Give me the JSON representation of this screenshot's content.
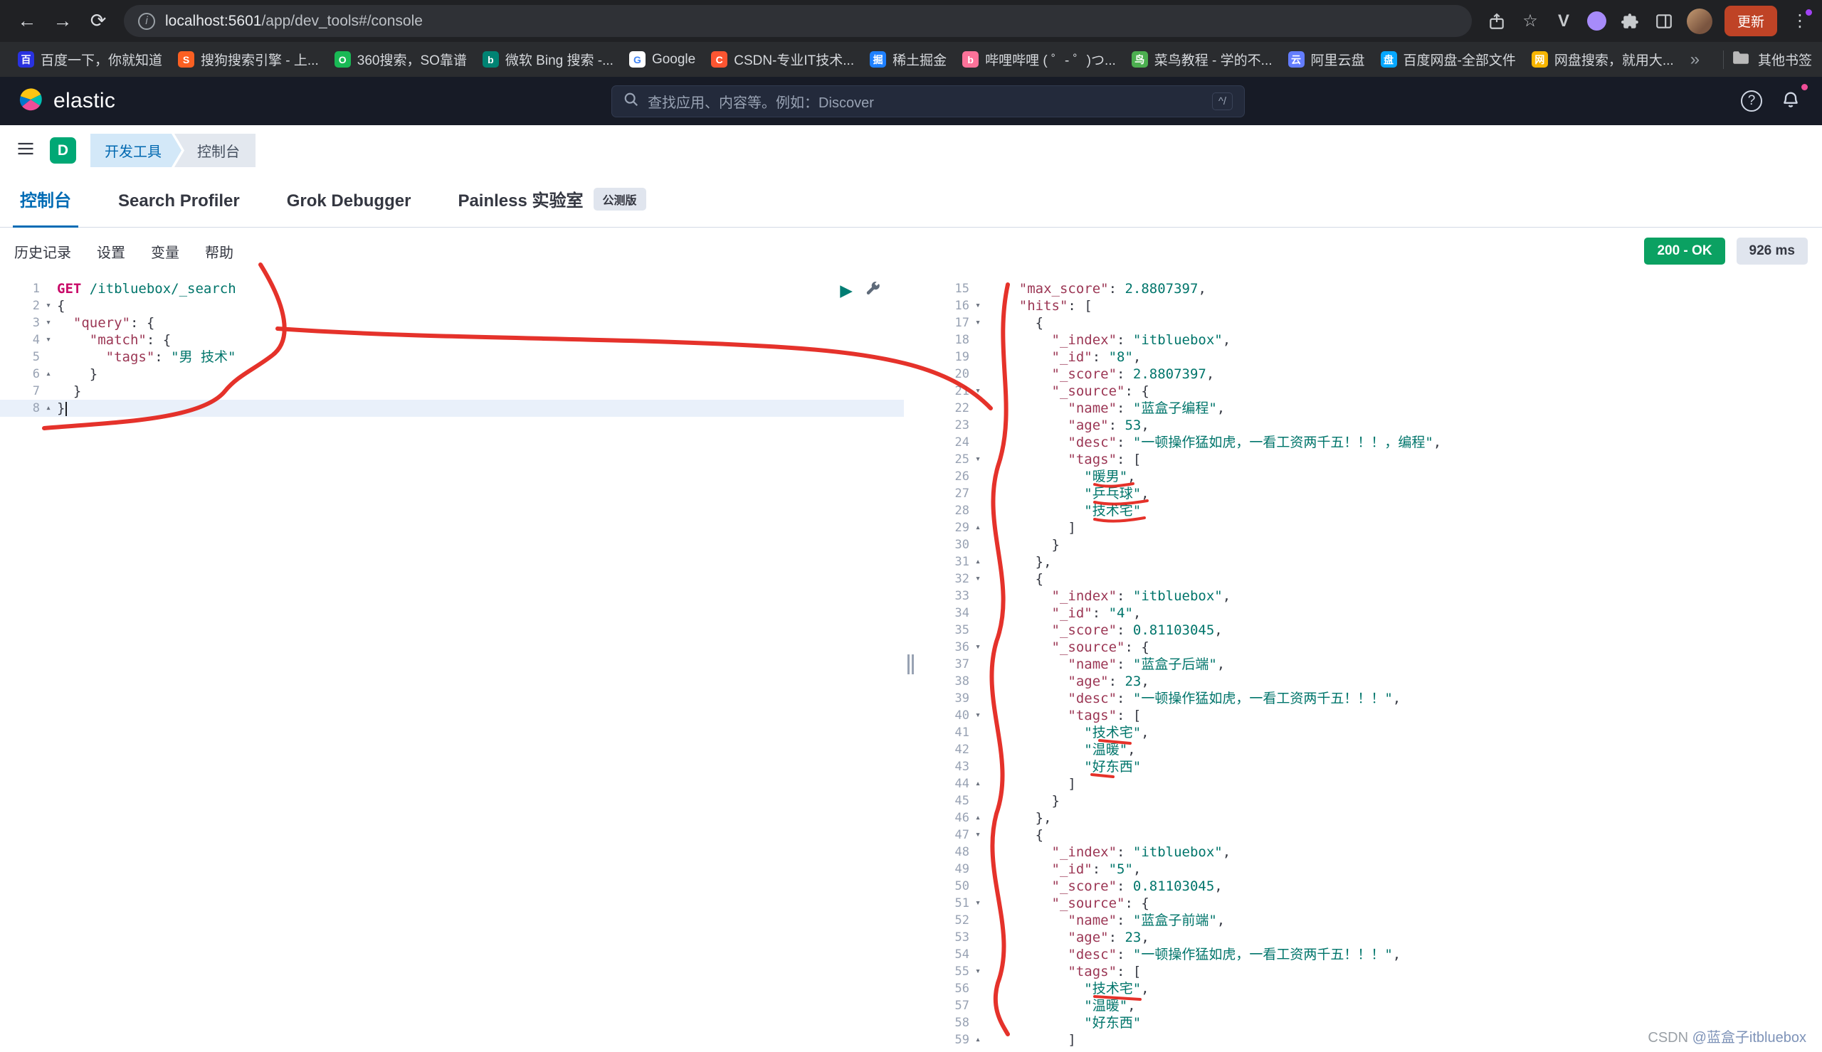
{
  "browser": {
    "url_host": "localhost:5601",
    "url_path": "/app/dev_tools#/console",
    "update_button": "更新",
    "overflow_chevron": "»",
    "other_bookmarks": "其他书签",
    "bookmarks": [
      {
        "label": "百度一下，你就知道",
        "glyph": "百",
        "color": "#2932e1"
      },
      {
        "label": "搜狗搜索引擎 - 上...",
        "glyph": "S",
        "color": "#fb6022"
      },
      {
        "label": "360搜索，SO靠谱",
        "glyph": "O",
        "color": "#19b955"
      },
      {
        "label": "微软 Bing 搜索 -...",
        "glyph": "b",
        "color": "#008373"
      },
      {
        "label": "Google",
        "glyph": "G",
        "color": "#ffffff",
        "fg": "#4285F4"
      },
      {
        "label": "CSDN-专业IT技术...",
        "glyph": "C",
        "color": "#fc5531"
      },
      {
        "label": "稀土掘金",
        "glyph": "掘",
        "color": "#1e80ff"
      },
      {
        "label": "哔哩哔哩 ( ゜- ゜)つ...",
        "glyph": "b",
        "color": "#fb7299"
      },
      {
        "label": "菜鸟教程 - 学的不...",
        "glyph": "鸟",
        "color": "#4caf50"
      },
      {
        "label": "阿里云盘",
        "glyph": "云",
        "color": "#637dff"
      },
      {
        "label": "百度网盘-全部文件",
        "glyph": "盘",
        "color": "#06a7ff"
      },
      {
        "label": "网盘搜索，就用大...",
        "glyph": "网",
        "color": "#f7b500"
      }
    ]
  },
  "header": {
    "brand": "elastic",
    "search_placeholder": "查找应用、内容等。例如：Discover",
    "search_shortcut": "^/"
  },
  "breadcrumbs": {
    "menu_badge": "D",
    "items": [
      {
        "label": "开发工具"
      },
      {
        "label": "控制台"
      }
    ]
  },
  "tabs": [
    {
      "label": "控制台",
      "active": true
    },
    {
      "label": "Search Profiler"
    },
    {
      "label": "Grok Debugger"
    },
    {
      "label": "Painless 实验室",
      "badge": "公测版"
    }
  ],
  "toolbar": {
    "links": [
      "历史记录",
      "设置",
      "变量",
      "帮助"
    ],
    "status_badge": "200 - OK",
    "time_badge": "926 ms"
  },
  "colors": {
    "accent_blue": "#006bb4",
    "success_green": "#0ba162",
    "annotation_red": "#e32119"
  },
  "editor": {
    "lines": [
      {
        "n": 1,
        "i": 0,
        "t": [
          [
            "m",
            "GET"
          ],
          [
            "p",
            " "
          ],
          [
            "u",
            "/itbluebox/_search"
          ]
        ]
      },
      {
        "n": 2,
        "i": 0,
        "f": "d",
        "t": [
          [
            "p",
            "{"
          ]
        ]
      },
      {
        "n": 3,
        "i": 2,
        "f": "d",
        "t": [
          [
            "k",
            "\"query\""
          ],
          [
            "p",
            ": {"
          ]
        ]
      },
      {
        "n": 4,
        "i": 4,
        "f": "d",
        "t": [
          [
            "k",
            "\"match\""
          ],
          [
            "p",
            ": {"
          ]
        ]
      },
      {
        "n": 5,
        "i": 6,
        "t": [
          [
            "k",
            "\"tags\""
          ],
          [
            "p",
            ": "
          ],
          [
            "s",
            "\"男 技术\""
          ]
        ]
      },
      {
        "n": 6,
        "i": 4,
        "f": "u",
        "t": [
          [
            "p",
            "}"
          ]
        ]
      },
      {
        "n": 7,
        "i": 2,
        "t": [
          [
            "p",
            "}"
          ]
        ]
      },
      {
        "n": 8,
        "i": 0,
        "f": "u",
        "active": true,
        "cursor": true,
        "t": [
          [
            "p",
            "}"
          ]
        ]
      }
    ]
  },
  "response": {
    "lines": [
      {
        "n": 15,
        "i": 4,
        "t": [
          [
            "k",
            "\"max_score\""
          ],
          [
            "p",
            ": "
          ],
          [
            "n",
            "2.8807397"
          ],
          [
            "p",
            ","
          ]
        ]
      },
      {
        "n": 16,
        "i": 4,
        "f": "d",
        "t": [
          [
            "k",
            "\"hits\""
          ],
          [
            "p",
            ": ["
          ]
        ]
      },
      {
        "n": 17,
        "i": 6,
        "f": "d",
        "t": [
          [
            "p",
            "{"
          ]
        ]
      },
      {
        "n": 18,
        "i": 8,
        "t": [
          [
            "k",
            "\"_index\""
          ],
          [
            "p",
            ": "
          ],
          [
            "s",
            "\"itbluebox\""
          ],
          [
            "p",
            ","
          ]
        ]
      },
      {
        "n": 19,
        "i": 8,
        "t": [
          [
            "k",
            "\"_id\""
          ],
          [
            "p",
            ": "
          ],
          [
            "s",
            "\"8\""
          ],
          [
            "p",
            ","
          ]
        ]
      },
      {
        "n": 20,
        "i": 8,
        "t": [
          [
            "k",
            "\"_score\""
          ],
          [
            "p",
            ": "
          ],
          [
            "n",
            "2.8807397"
          ],
          [
            "p",
            ","
          ]
        ]
      },
      {
        "n": 21,
        "i": 8,
        "f": "d",
        "t": [
          [
            "k",
            "\"_source\""
          ],
          [
            "p",
            ": {"
          ]
        ]
      },
      {
        "n": 22,
        "i": 10,
        "t": [
          [
            "k",
            "\"name\""
          ],
          [
            "p",
            ": "
          ],
          [
            "s",
            "\"蓝盒子编程\""
          ],
          [
            "p",
            ","
          ]
        ]
      },
      {
        "n": 23,
        "i": 10,
        "t": [
          [
            "k",
            "\"age\""
          ],
          [
            "p",
            ": "
          ],
          [
            "n",
            "53"
          ],
          [
            "p",
            ","
          ]
        ]
      },
      {
        "n": 24,
        "i": 10,
        "t": [
          [
            "k",
            "\"desc\""
          ],
          [
            "p",
            ": "
          ],
          [
            "s",
            "\"一顿操作猛如虎，一看工资两千五！！！，编程\""
          ],
          [
            "p",
            ","
          ]
        ]
      },
      {
        "n": 25,
        "i": 10,
        "f": "d",
        "t": [
          [
            "k",
            "\"tags\""
          ],
          [
            "p",
            ": ["
          ]
        ]
      },
      {
        "n": 26,
        "i": 12,
        "t": [
          [
            "s",
            "\"暖男\""
          ],
          [
            "p",
            ","
          ]
        ]
      },
      {
        "n": 27,
        "i": 12,
        "t": [
          [
            "s",
            "\"乒乓球\""
          ],
          [
            "p",
            ","
          ]
        ]
      },
      {
        "n": 28,
        "i": 12,
        "t": [
          [
            "s",
            "\"技术宅\""
          ]
        ]
      },
      {
        "n": 29,
        "i": 10,
        "f": "u",
        "t": [
          [
            "p",
            "]"
          ]
        ]
      },
      {
        "n": 30,
        "i": 8,
        "t": [
          [
            "p",
            "}"
          ]
        ]
      },
      {
        "n": 31,
        "i": 6,
        "f": "u",
        "t": [
          [
            "p",
            "},"
          ]
        ]
      },
      {
        "n": 32,
        "i": 6,
        "f": "d",
        "t": [
          [
            "p",
            "{"
          ]
        ]
      },
      {
        "n": 33,
        "i": 8,
        "t": [
          [
            "k",
            "\"_index\""
          ],
          [
            "p",
            ": "
          ],
          [
            "s",
            "\"itbluebox\""
          ],
          [
            "p",
            ","
          ]
        ]
      },
      {
        "n": 34,
        "i": 8,
        "t": [
          [
            "k",
            "\"_id\""
          ],
          [
            "p",
            ": "
          ],
          [
            "s",
            "\"4\""
          ],
          [
            "p",
            ","
          ]
        ]
      },
      {
        "n": 35,
        "i": 8,
        "t": [
          [
            "k",
            "\"_score\""
          ],
          [
            "p",
            ": "
          ],
          [
            "n",
            "0.81103045"
          ],
          [
            "p",
            ","
          ]
        ]
      },
      {
        "n": 36,
        "i": 8,
        "f": "d",
        "t": [
          [
            "k",
            "\"_source\""
          ],
          [
            "p",
            ": {"
          ]
        ]
      },
      {
        "n": 37,
        "i": 10,
        "t": [
          [
            "k",
            "\"name\""
          ],
          [
            "p",
            ": "
          ],
          [
            "s",
            "\"蓝盒子后端\""
          ],
          [
            "p",
            ","
          ]
        ]
      },
      {
        "n": 38,
        "i": 10,
        "t": [
          [
            "k",
            "\"age\""
          ],
          [
            "p",
            ": "
          ],
          [
            "n",
            "23"
          ],
          [
            "p",
            ","
          ]
        ]
      },
      {
        "n": 39,
        "i": 10,
        "t": [
          [
            "k",
            "\"desc\""
          ],
          [
            "p",
            ": "
          ],
          [
            "s",
            "\"一顿操作猛如虎，一看工资两千五！！！\""
          ],
          [
            "p",
            ","
          ]
        ]
      },
      {
        "n": 40,
        "i": 10,
        "f": "d",
        "t": [
          [
            "k",
            "\"tags\""
          ],
          [
            "p",
            ": ["
          ]
        ]
      },
      {
        "n": 41,
        "i": 12,
        "t": [
          [
            "s",
            "\"技术宅\""
          ],
          [
            "p",
            ","
          ]
        ]
      },
      {
        "n": 42,
        "i": 12,
        "t": [
          [
            "s",
            "\"温暖\""
          ],
          [
            "p",
            ","
          ]
        ]
      },
      {
        "n": 43,
        "i": 12,
        "t": [
          [
            "s",
            "\"好东西\""
          ]
        ]
      },
      {
        "n": 44,
        "i": 10,
        "f": "u",
        "t": [
          [
            "p",
            "]"
          ]
        ]
      },
      {
        "n": 45,
        "i": 8,
        "t": [
          [
            "p",
            "}"
          ]
        ]
      },
      {
        "n": 46,
        "i": 6,
        "f": "u",
        "t": [
          [
            "p",
            "},"
          ]
        ]
      },
      {
        "n": 47,
        "i": 6,
        "f": "d",
        "t": [
          [
            "p",
            "{"
          ]
        ]
      },
      {
        "n": 48,
        "i": 8,
        "t": [
          [
            "k",
            "\"_index\""
          ],
          [
            "p",
            ": "
          ],
          [
            "s",
            "\"itbluebox\""
          ],
          [
            "p",
            ","
          ]
        ]
      },
      {
        "n": 49,
        "i": 8,
        "t": [
          [
            "k",
            "\"_id\""
          ],
          [
            "p",
            ": "
          ],
          [
            "s",
            "\"5\""
          ],
          [
            "p",
            ","
          ]
        ]
      },
      {
        "n": 50,
        "i": 8,
        "t": [
          [
            "k",
            "\"_score\""
          ],
          [
            "p",
            ": "
          ],
          [
            "n",
            "0.81103045"
          ],
          [
            "p",
            ","
          ]
        ]
      },
      {
        "n": 51,
        "i": 8,
        "f": "d",
        "t": [
          [
            "k",
            "\"_source\""
          ],
          [
            "p",
            ": {"
          ]
        ]
      },
      {
        "n": 52,
        "i": 10,
        "t": [
          [
            "k",
            "\"name\""
          ],
          [
            "p",
            ": "
          ],
          [
            "s",
            "\"蓝盒子前端\""
          ],
          [
            "p",
            ","
          ]
        ]
      },
      {
        "n": 53,
        "i": 10,
        "t": [
          [
            "k",
            "\"age\""
          ],
          [
            "p",
            ": "
          ],
          [
            "n",
            "23"
          ],
          [
            "p",
            ","
          ]
        ]
      },
      {
        "n": 54,
        "i": 10,
        "t": [
          [
            "k",
            "\"desc\""
          ],
          [
            "p",
            ": "
          ],
          [
            "s",
            "\"一顿操作猛如虎，一看工资两千五！！！\""
          ],
          [
            "p",
            ","
          ]
        ]
      },
      {
        "n": 55,
        "i": 10,
        "f": "d",
        "t": [
          [
            "k",
            "\"tags\""
          ],
          [
            "p",
            ": ["
          ]
        ]
      },
      {
        "n": 56,
        "i": 12,
        "t": [
          [
            "s",
            "\"技术宅\""
          ],
          [
            "p",
            ","
          ]
        ]
      },
      {
        "n": 57,
        "i": 12,
        "t": [
          [
            "s",
            "\"温暖\""
          ],
          [
            "p",
            ","
          ]
        ]
      },
      {
        "n": 58,
        "i": 12,
        "t": [
          [
            "s",
            "\"好东西\""
          ]
        ]
      },
      {
        "n": 59,
        "i": 10,
        "f": "u",
        "t": [
          [
            "p",
            "]"
          ]
        ]
      }
    ]
  },
  "watermark": {
    "prefix": "CSDN ",
    "handle": "@蓝盒子itbluebox"
  }
}
